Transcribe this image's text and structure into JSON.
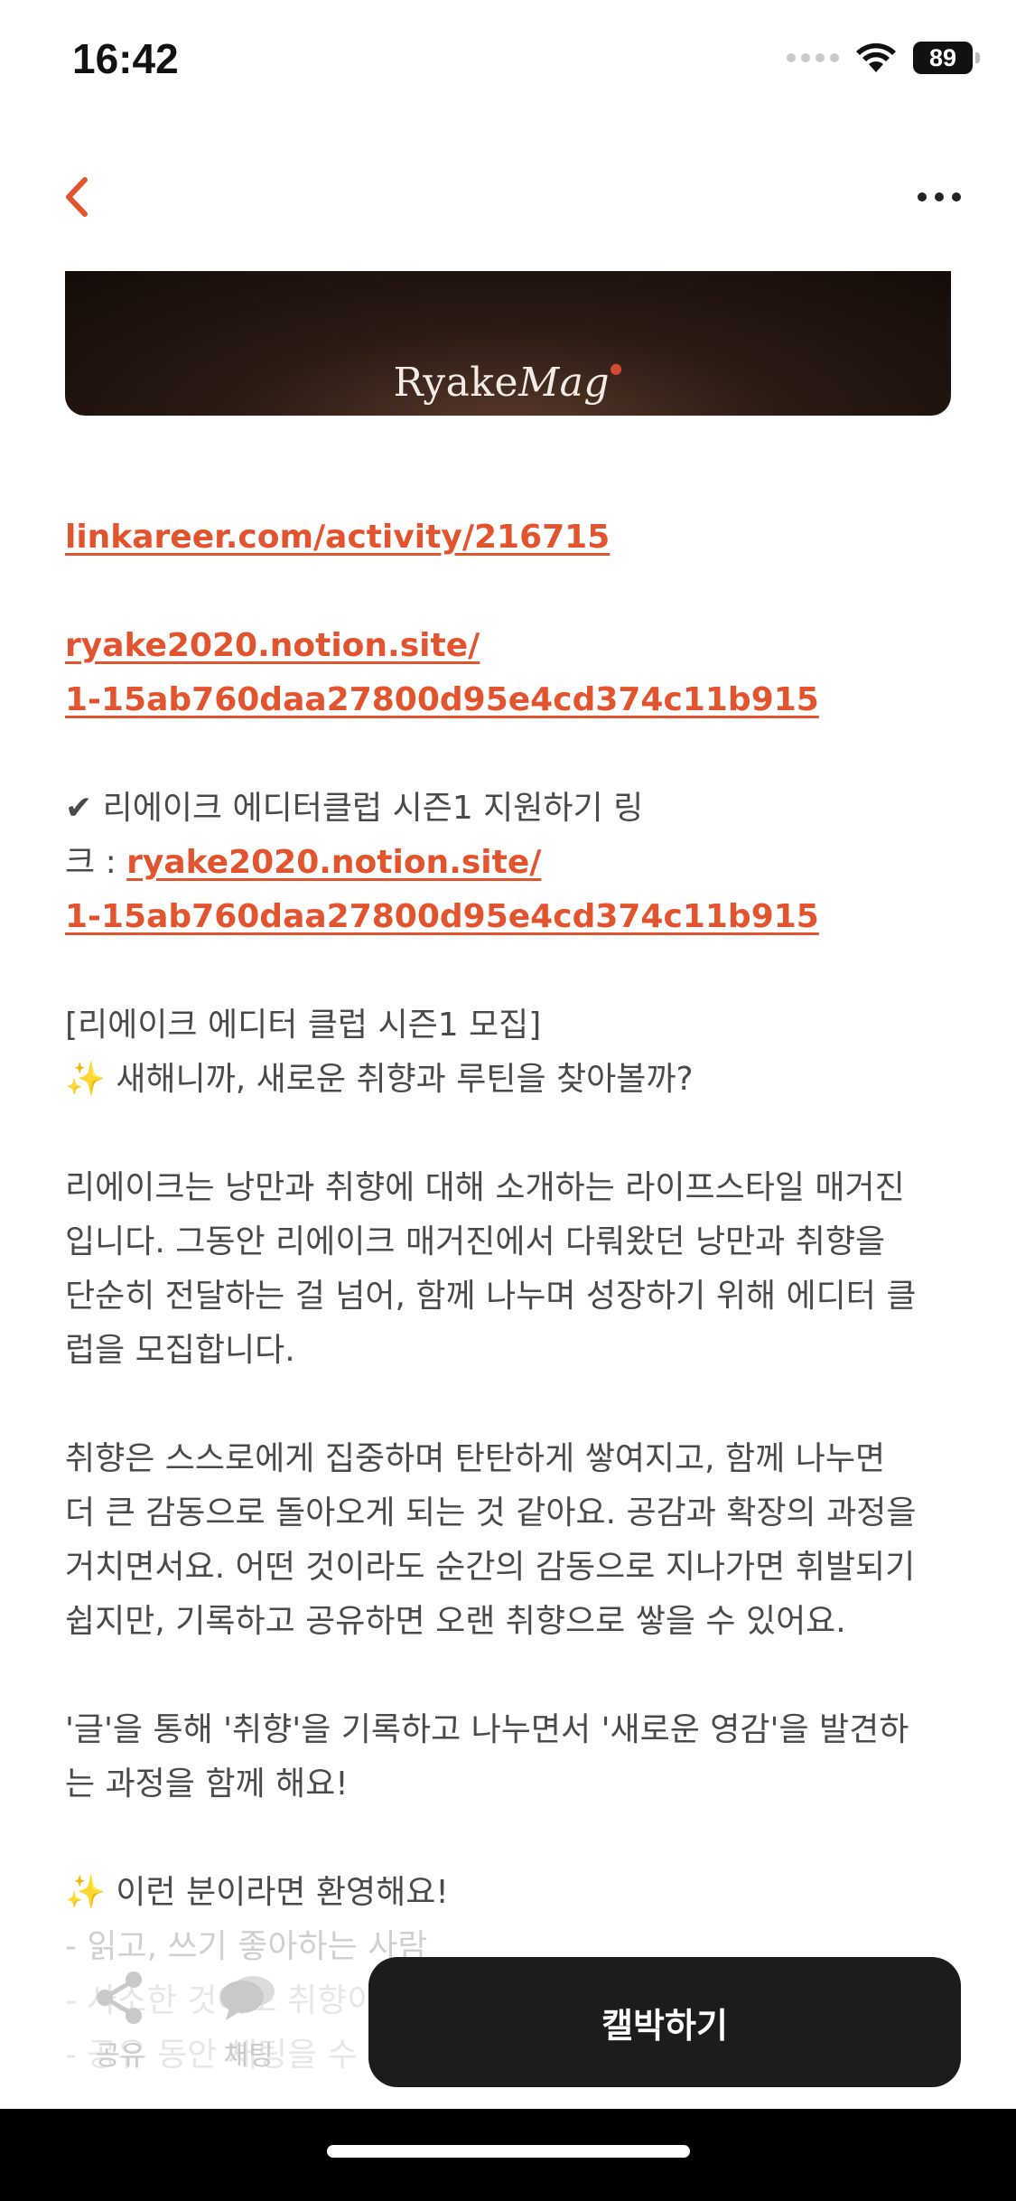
{
  "status": {
    "time": "16:42",
    "battery": "89",
    "icons": [
      "signal-icon",
      "wifi-icon",
      "battery-icon"
    ]
  },
  "nav": {
    "back_icon": "chevron-left-icon",
    "more_icon": "more-horizontal-icon"
  },
  "banner": {
    "logo_main": "Ryake",
    "logo_italic": "Mag"
  },
  "article": {
    "link1": "linkareer.com/activity/216715",
    "link2_a": "ryake2020.notion.site/",
    "link2_b": "1-15ab760daa27800d95e4cd374c11b915",
    "apply_prefix_a": "✔︎ 리에이크 에디터클럽 시즌1 지원하기 링",
    "apply_prefix_b": "크 : ",
    "apply_link_a": "ryake2020.notion.site/",
    "apply_link_b": "1-15ab760daa27800d95e4cd374c11b915",
    "recruit_title": "[리에이크 에디터 클럽 시즌1 모집]",
    "recruit_sub": "✨ 새해니까, 새로운 취향과 루틴을 찾아볼까?",
    "para1": [
      "리에이크는 낭만과 취향에 대해 소개하는 라이프스타일 매거진",
      "입니다. 그동안 리에이크 매거진에서 다뤄왔던 낭만과 취향을",
      "단순히 전달하는 걸 넘어, 함께 나누며 성장하기 위해 에디터 클",
      "럽을 모집합니다."
    ],
    "para2": [
      "취향은 스스로에게 집중하며 탄탄하게 쌓여지고, 함께 나누면",
      "더 큰 감동으로 돌아오게 되는 것 같아요. 공감과 확장의 과정을",
      "거치면서요. 어떤 것이라도 순간의 감동으로 지나가면 휘발되기",
      "쉽지만, 기록하고 공유하면 오랜 취향으로 쌓을 수 있어요."
    ],
    "para3": [
      "'글'을 통해 '취향'을 기록하고 나누면서 '새로운 영감'을 발견하",
      "는 과정을 함께 해요!"
    ],
    "welcome_title": "✨ 이런 분이라면 환영해요!",
    "welcome_items": [
      "- 읽고, 쓰기 좋아하는 사람",
      "- 사소한 것에도 취향이 있는 사람",
      "- 공유 동안 채팅을 수"
    ]
  },
  "bottom": {
    "share_label": "공유",
    "chat_label": "채팅",
    "primary_label": "캘박하기",
    "share_icon": "share-icon",
    "chat_icon": "chat-bubbles-icon"
  },
  "colors": {
    "accent": "#e2542e",
    "text": "#4a4a4a",
    "button_bg": "#1c1c1c"
  }
}
